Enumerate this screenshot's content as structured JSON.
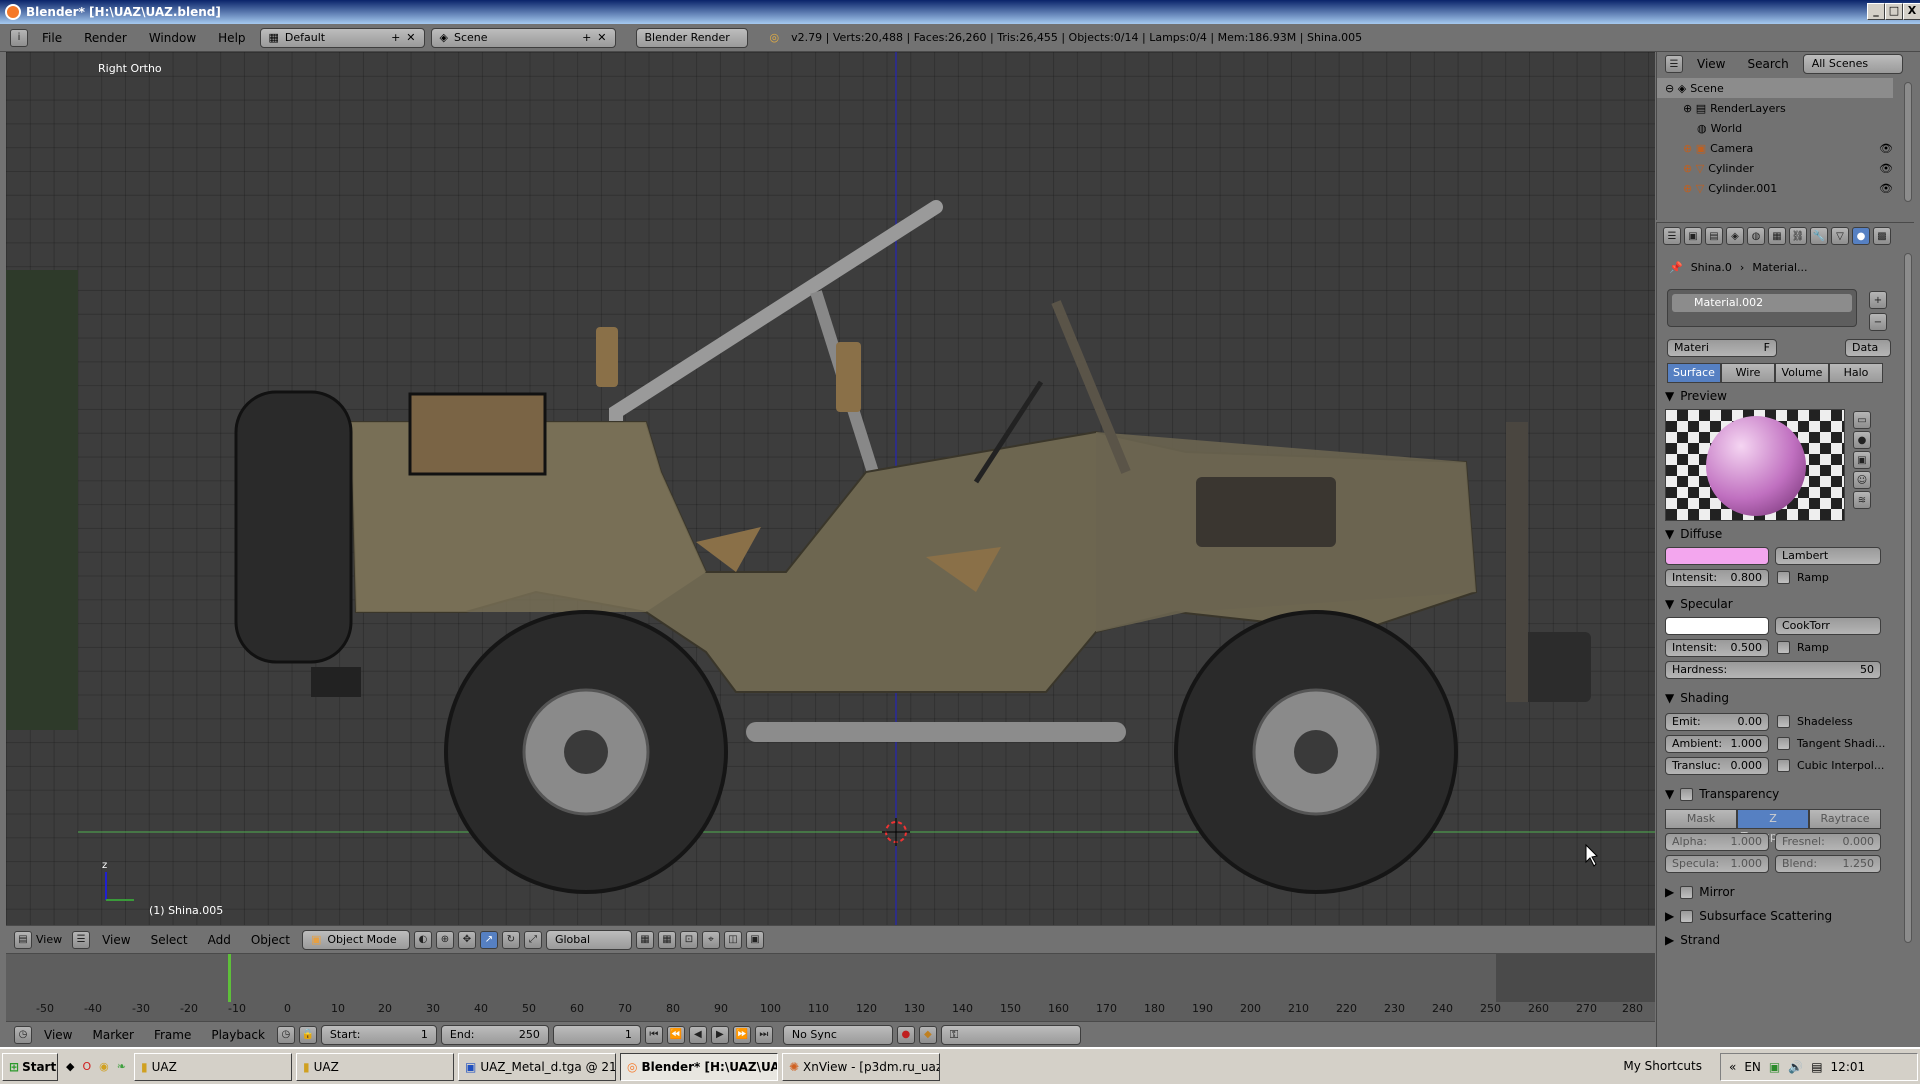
{
  "window": {
    "title": "Blender* [H:\\UAZ\\UAZ.blend]",
    "min": "_",
    "max": "□",
    "close": "X"
  },
  "menu": {
    "items": [
      "File",
      "Render",
      "Window",
      "Help"
    ]
  },
  "header": {
    "layout": "Default",
    "scene": "Scene",
    "engine": "Blender Render",
    "stats": "v2.79 | Verts:20,488 | Faces:26,260 | Tris:26,455 | Objects:0/14 | Lamps:0/4 | Mem:186.93M | Shina.005"
  },
  "viewport": {
    "view_name": "Right Ortho",
    "active_object": "(1) Shina.005",
    "axis_z": "z"
  },
  "view3d_header": {
    "menus": [
      "View",
      "Select",
      "Add",
      "Object"
    ],
    "mode": "Object Mode",
    "orientation": "Global",
    "editor_label": "View"
  },
  "timeline": {
    "ticks": [
      "-50",
      "-40",
      "-30",
      "-20",
      "-10",
      "0",
      "10",
      "20",
      "30",
      "40",
      "50",
      "60",
      "70",
      "80",
      "90",
      "100",
      "110",
      "120",
      "130",
      "140",
      "150",
      "160",
      "170",
      "180",
      "190",
      "200",
      "210",
      "220",
      "230",
      "240",
      "250",
      "260",
      "270",
      "280"
    ],
    "current_frame_tick": "0"
  },
  "timeline_header": {
    "menus": [
      "View",
      "Marker",
      "Frame",
      "Playback"
    ],
    "start_label": "Start:",
    "start": "1",
    "end_label": "End:",
    "end": "250",
    "current": "1",
    "sync": "No Sync"
  },
  "outliner": {
    "menus": [
      "View",
      "Search"
    ],
    "filter": "All Scenes",
    "items": [
      "Scene",
      "RenderLayers",
      "World",
      "Camera",
      "Cylinder",
      "Cylinder.001"
    ]
  },
  "properties": {
    "breadcrumb": [
      "Shina.0",
      "Material..."
    ],
    "material_slot": "Material.002",
    "datablock": "Materi",
    "datablock_f": "F",
    "data_dropdown": "Data",
    "tabs": [
      "Surface",
      "Wire",
      "Volume",
      "Halo"
    ],
    "active_tab": "Surface",
    "panels": {
      "preview": "Preview",
      "diffuse": "Diffuse",
      "specular": "Specular",
      "shading": "Shading",
      "transparency": "Transparency",
      "mirror": "Mirror",
      "sss": "Subsurface Scattering",
      "strand": "Strand"
    },
    "diffuse": {
      "color": "#f3a6ee",
      "shader": "Lambert",
      "intensity_label": "Intensit:",
      "intensity": "0.800",
      "ramp": "Ramp"
    },
    "specular": {
      "color": "#ffffff",
      "shader": "CookTorr",
      "intensity_label": "Intensit:",
      "intensity": "0.500",
      "ramp": "Ramp",
      "hardness_label": "Hardness:",
      "hardness": "50"
    },
    "shading": {
      "emit_label": "Emit:",
      "emit": "0.00",
      "ambient_label": "Ambient:",
      "ambient": "1.000",
      "transluc_label": "Transluc:",
      "transluc": "0.000",
      "shadeless": "Shadeless",
      "tangent": "Tangent Shadi...",
      "cubic": "Cubic Interpol..."
    },
    "transparency": {
      "modes": [
        "Mask",
        "Z Transpare...",
        "Raytrace"
      ],
      "alpha_label": "Alpha:",
      "alpha": "1.000",
      "fresnel_label": "Fresnel:",
      "fresnel": "0.000",
      "specula_label": "Specula:",
      "specula": "1.000",
      "blend_label": "Blend:",
      "blend": "1.250"
    }
  },
  "taskbar": {
    "start": "Start",
    "tasks": [
      "UAZ",
      "UAZ",
      "UAZ_Metal_d.tga @ 21...",
      "Blender* [H:\\UAZ\\UA...",
      "XnView - [p3dm.ru_uaz..."
    ],
    "active_task": 3,
    "shortcuts": "My Shortcuts",
    "lang": "EN",
    "clock": "12:01"
  }
}
